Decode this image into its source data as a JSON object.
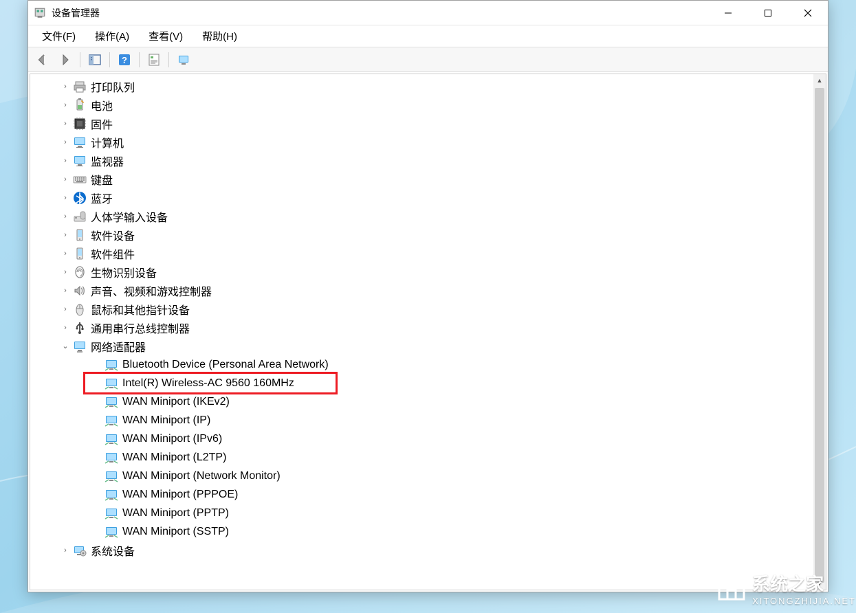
{
  "window": {
    "title": "设备管理器",
    "menus": [
      "文件(F)",
      "操作(A)",
      "查看(V)",
      "帮助(H)"
    ]
  },
  "toolbar": {
    "back": "后退",
    "forward": "前进",
    "show_folders": "显示/隐藏控制台树",
    "help": "帮助",
    "properties": "属性",
    "scan": "扫描硬件改动"
  },
  "tree": {
    "categories": [
      {
        "label": "打印队列",
        "icon": "printer"
      },
      {
        "label": "电池",
        "icon": "battery"
      },
      {
        "label": "固件",
        "icon": "firmware"
      },
      {
        "label": "计算机",
        "icon": "monitor"
      },
      {
        "label": "监视器",
        "icon": "monitor"
      },
      {
        "label": "键盘",
        "icon": "keyboard"
      },
      {
        "label": "蓝牙",
        "icon": "bluetooth"
      },
      {
        "label": "人体学输入设备",
        "icon": "hid"
      },
      {
        "label": "软件设备",
        "icon": "software"
      },
      {
        "label": "软件组件",
        "icon": "software"
      },
      {
        "label": "生物识别设备",
        "icon": "biometric"
      },
      {
        "label": "声音、视频和游戏控制器",
        "icon": "sound"
      },
      {
        "label": "鼠标和其他指针设备",
        "icon": "mouse"
      },
      {
        "label": "通用串行总线控制器",
        "icon": "usb"
      },
      {
        "label": "网络适配器",
        "icon": "network",
        "expanded": true,
        "children": [
          {
            "label": "Bluetooth Device (Personal Area Network)"
          },
          {
            "label": "Intel(R) Wireless-AC 9560 160MHz",
            "highlighted": true
          },
          {
            "label": "WAN Miniport (IKEv2)"
          },
          {
            "label": "WAN Miniport (IP)"
          },
          {
            "label": "WAN Miniport (IPv6)"
          },
          {
            "label": "WAN Miniport (L2TP)"
          },
          {
            "label": "WAN Miniport (Network Monitor)"
          },
          {
            "label": "WAN Miniport (PPPOE)"
          },
          {
            "label": "WAN Miniport (PPTP)"
          },
          {
            "label": "WAN Miniport (SSTP)"
          }
        ]
      },
      {
        "label": "系统设备",
        "icon": "system"
      }
    ]
  },
  "watermark": {
    "brand": "系统之家",
    "url": "XITONGZHIJIA.NET"
  }
}
